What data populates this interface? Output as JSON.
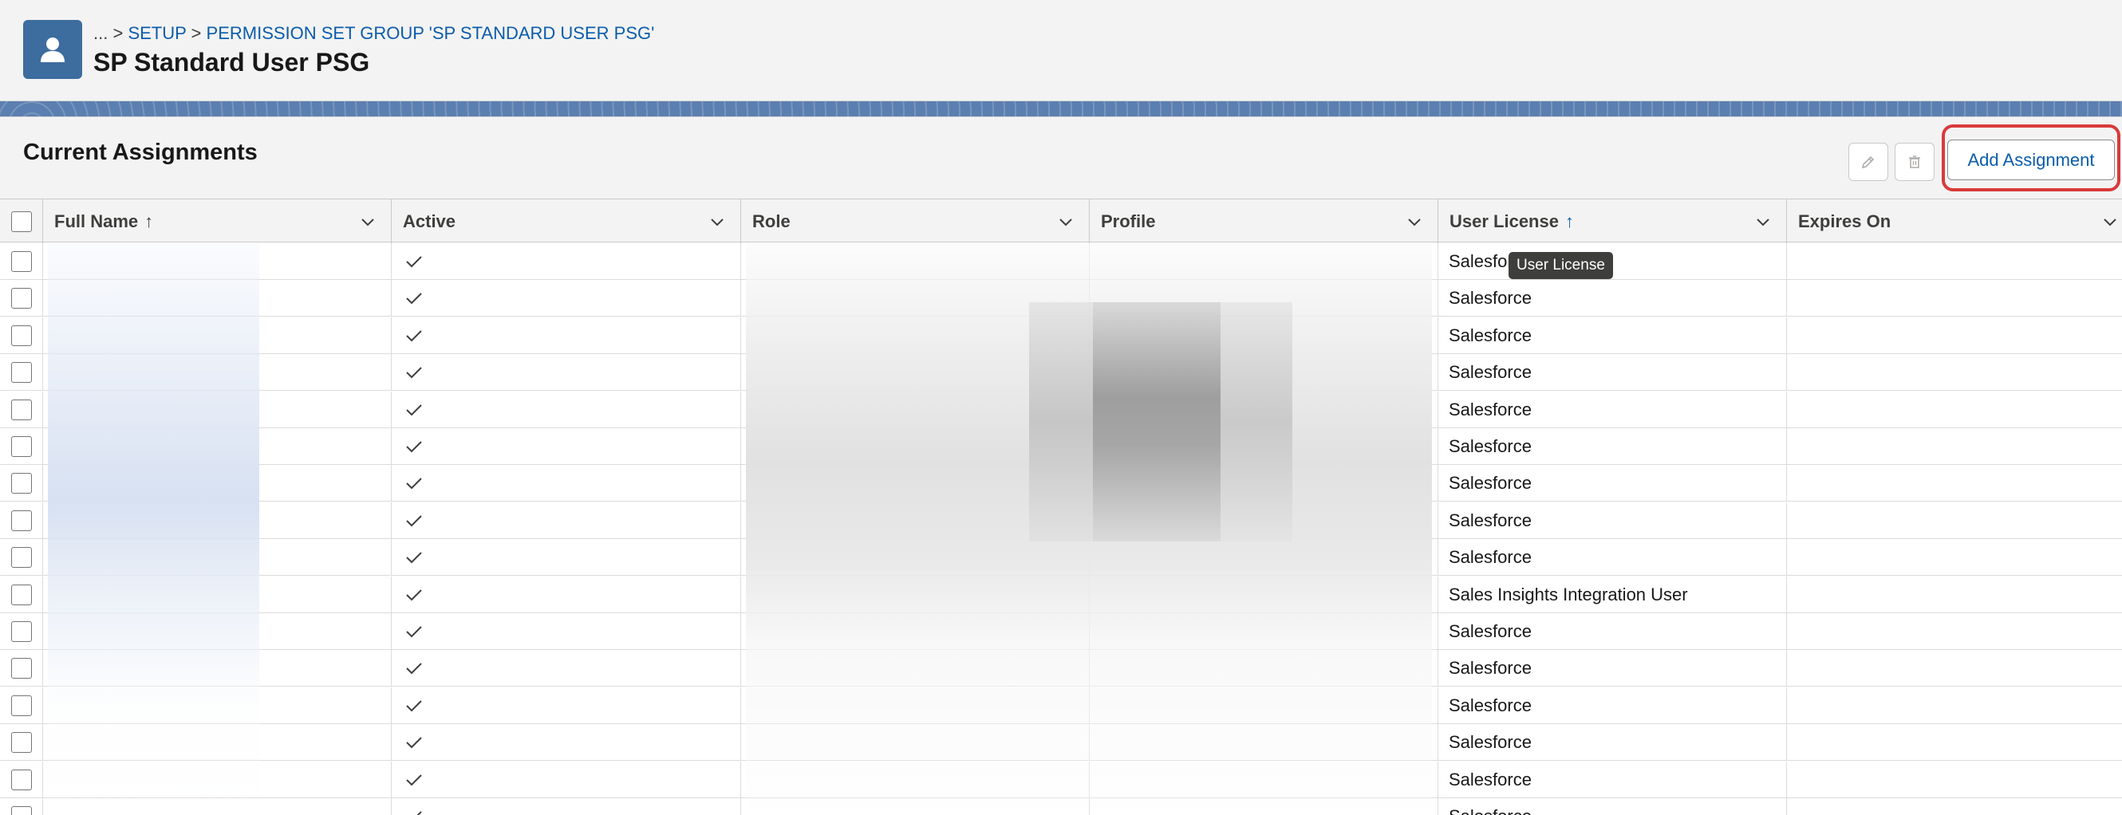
{
  "header": {
    "breadcrumb": {
      "ellipsis": "...",
      "separator": ">",
      "items": [
        "SETUP",
        "PERMISSION SET GROUP 'SP STANDARD USER PSG'"
      ]
    },
    "title": "SP Standard User PSG",
    "icon": "user-icon"
  },
  "card": {
    "title": "Current Assignments",
    "edit_icon": "pencil-icon",
    "delete_icon": "trash-icon",
    "add_button_label": "Add Assignment"
  },
  "table": {
    "columns": [
      {
        "label": "Full Name",
        "sort": "↑"
      },
      {
        "label": "Active",
        "sort": ""
      },
      {
        "label": "Role",
        "sort": ""
      },
      {
        "label": "Profile",
        "sort": ""
      },
      {
        "label": "User License",
        "sort": "↑"
      },
      {
        "label": "Expires On",
        "sort": ""
      }
    ],
    "rows": [
      {
        "active": true,
        "license": "Salesforce",
        "expires": ""
      },
      {
        "active": true,
        "license": "Salesforce",
        "expires": ""
      },
      {
        "active": true,
        "license": "Salesforce",
        "expires": ""
      },
      {
        "active": true,
        "license": "Salesforce",
        "expires": ""
      },
      {
        "active": true,
        "license": "Salesforce",
        "expires": ""
      },
      {
        "active": true,
        "license": "Salesforce",
        "expires": ""
      },
      {
        "active": true,
        "license": "Salesforce",
        "expires": ""
      },
      {
        "active": true,
        "license": "Salesforce",
        "expires": ""
      },
      {
        "active": true,
        "license": "Salesforce",
        "expires": ""
      },
      {
        "active": true,
        "license": "Sales Insights Integration User",
        "expires": ""
      },
      {
        "active": true,
        "license": "Salesforce",
        "expires": ""
      },
      {
        "active": true,
        "license": "Salesforce",
        "expires": ""
      },
      {
        "active": true,
        "license": "Salesforce",
        "expires": ""
      },
      {
        "active": true,
        "license": "Salesforce",
        "expires": ""
      },
      {
        "active": true,
        "license": "Salesforce",
        "expires": ""
      },
      {
        "active": true,
        "license": "Salesforce",
        "expires": ""
      }
    ]
  },
  "tooltip": {
    "text": "User License"
  },
  "colors": {
    "brand": "#3d6c9e",
    "link": "#0b5cab",
    "highlight": "#d93a3a"
  }
}
